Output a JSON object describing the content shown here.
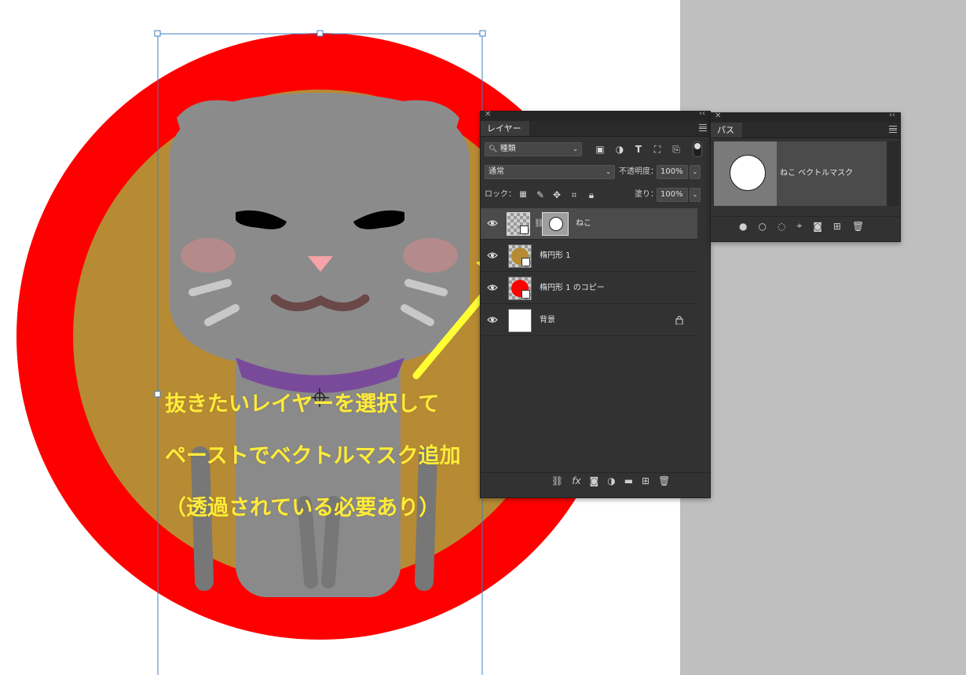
{
  "annotation": {
    "line1": "抜きたいレイヤーを選択して",
    "line2": "ペーストでベクトルマスク追加",
    "line3": "（透過されている必要あり）"
  },
  "layers_panel": {
    "tab_label": "レイヤー",
    "filter_label": "種類",
    "blend_mode": "通常",
    "opacity_label": "不透明度：",
    "opacity_value": "100%",
    "lock_label": "ロック：",
    "fill_label": "塗り：",
    "fill_value": "100%",
    "layers": [
      {
        "name": "ねこ",
        "selected": true
      },
      {
        "name": "楕円形 1",
        "selected": false
      },
      {
        "name": "楕円形 1 のコピー",
        "selected": false
      },
      {
        "name": "背景",
        "selected": false,
        "locked": true
      }
    ],
    "footer_fx": "fx"
  },
  "paths_panel": {
    "tab_label": "パス",
    "path_name": "ねこ ベクトルマスク"
  },
  "colors": {
    "ring": "#ff0000",
    "gold": "#b78b34",
    "cat": "#8a8a8a",
    "arrow": "#ffff33",
    "annotation_text": "#ffeb3b"
  }
}
